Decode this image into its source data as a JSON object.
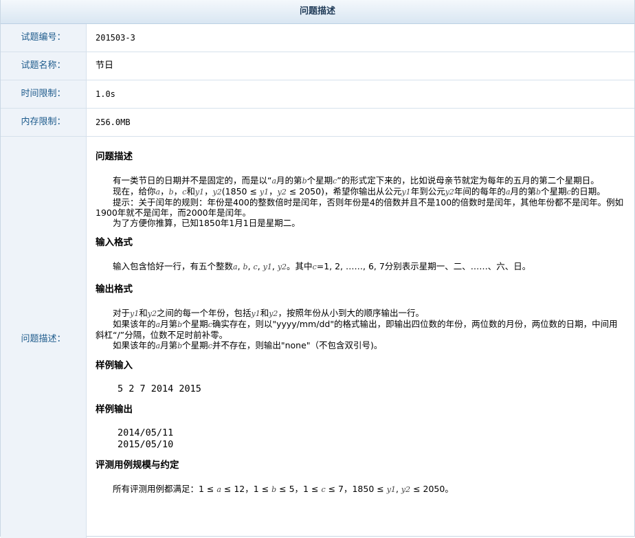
{
  "header": {
    "title": "问题描述"
  },
  "meta": {
    "id": {
      "label": "试题编号：",
      "value": "201503-3"
    },
    "name": {
      "label": "试题名称：",
      "value": "节日"
    },
    "time": {
      "label": "时间限制：",
      "value": "1.0s"
    },
    "memory": {
      "label": "内存限制：",
      "value": "256.0MB"
    }
  },
  "desc_label": "问题描述：",
  "problem": {
    "heading": "问题描述",
    "p1": [
      "有一类节日的日期并不是固定的，而是以“",
      "a",
      "月的第",
      "b",
      "个星期",
      "c",
      "”的形式定下来的，比如说母亲节就定为每年的五月的第二个星期日。"
    ],
    "p2": [
      "现在，给你",
      "a",
      "，",
      "b",
      "，",
      "c",
      "和",
      "y1",
      "，",
      "y2",
      "(1850 ≤ ",
      "y1",
      "，",
      "y2",
      " ≤ 2050)，希望你输出从公元",
      "y1",
      "年到公元",
      "y2",
      "年间的每年的",
      "a",
      "月的第",
      "b",
      "个星期",
      "c",
      "的日期。"
    ],
    "p3": "提示：关于闰年的规则：年份是400的整数倍时是闰年，否则年份是4的倍数并且不是100的倍数时是闰年，其他年份都不是闰年。例如1900年就不是闰年，而2000年是闰年。",
    "p4": "为了方便你推算，已知1850年1月1日是星期二。"
  },
  "input": {
    "heading": "输入格式",
    "p1": [
      "输入包含恰好一行，有五个整数",
      "a",
      ", ",
      "b",
      ", ",
      "c",
      ", ",
      "y1",
      ", ",
      "y2",
      "。其中",
      "c",
      "=1, 2, ……, 6, 7分别表示星期一、二、……、六、日。"
    ]
  },
  "output": {
    "heading": "输出格式",
    "p1": [
      "对于",
      "y1",
      "和",
      "y2",
      "之间的每一个年份，包括",
      "y1",
      "和",
      "y2",
      "，按照年份从小到大的顺序输出一行。"
    ],
    "p2": [
      "如果该年的",
      "a",
      "月第",
      "b",
      "个星期",
      "c",
      "确实存在，则以\"yyyy/mm/dd\"的格式输出，即输出四位数的年份，两位数的月份，两位数的日期，中间用斜杠“/”分隔，位数不足时前补零。"
    ],
    "p3": [
      "如果该年的",
      "a",
      "月第",
      "b",
      "个星期",
      "c",
      "并不存在，则输出\"none\"（不包含双引号)。"
    ]
  },
  "sample_in": {
    "heading": "样例输入",
    "code": "5 2 7 2014 2015"
  },
  "sample_out": {
    "heading": "样例输出",
    "code": "2014/05/11\n2015/05/10"
  },
  "constraints": {
    "heading": "评测用例规模与约定",
    "p1": [
      "所有评测用例都满足：1 ≤ ",
      "a",
      " ≤ 12，1 ≤ ",
      "b",
      " ≤ 5，1 ≤ ",
      "c",
      " ≤ 7，1850 ≤ ",
      "y1",
      ", ",
      "y2",
      " ≤ 2050。"
    ]
  }
}
